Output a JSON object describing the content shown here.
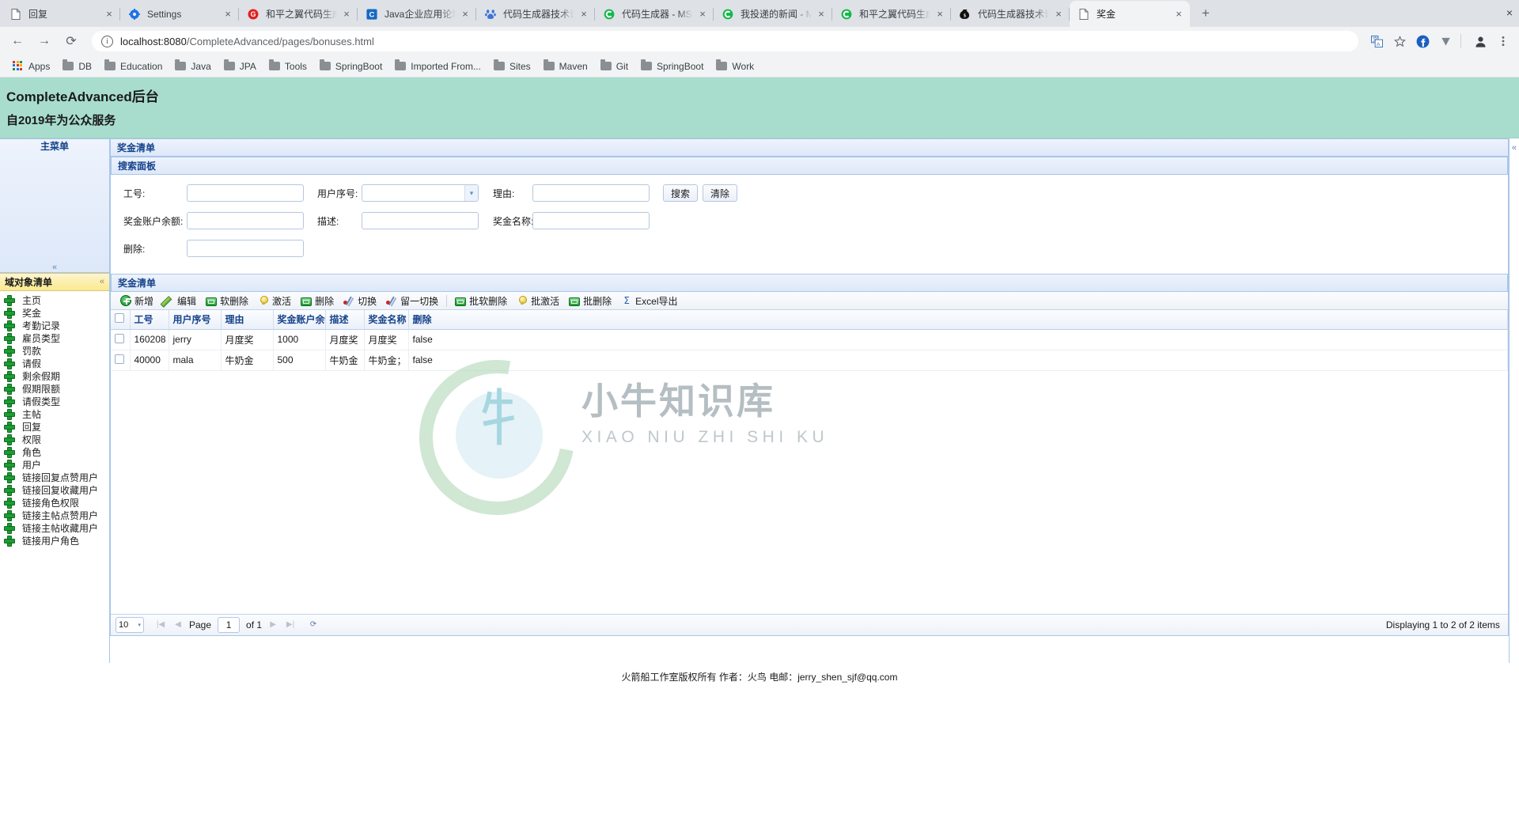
{
  "browser": {
    "tabs": [
      {
        "title": "回复",
        "favicon": "doc-icon",
        "active": false
      },
      {
        "title": "Settings",
        "favicon": "gear-icon",
        "active": false
      },
      {
        "title": "和平之翼代码生成",
        "favicon": "g-red-icon",
        "active": false
      },
      {
        "title": "Java企业应用论坛",
        "favicon": "c-blue-icon",
        "active": false
      },
      {
        "title": "代码生成器技术论",
        "favicon": "baidu-icon",
        "active": false
      },
      {
        "title": "代码生成器 - MSD",
        "favicon": "c-green-icon",
        "active": false
      },
      {
        "title": "我投递的新闻 - M",
        "favicon": "c-green-icon",
        "active": false
      },
      {
        "title": "和平之翼代码生成",
        "favicon": "c-green-icon",
        "active": false
      },
      {
        "title": "代码生成器技术论",
        "favicon": "moneybag-icon",
        "active": false
      },
      {
        "title": "奖金",
        "favicon": "doc-icon",
        "active": true
      }
    ],
    "tab_close_label": "×",
    "new_tab_label": "+",
    "window_close_label": "×",
    "nav": {
      "back": "←",
      "forward": "→",
      "reload": "⟳"
    },
    "omnibox": {
      "info_glyph": "i",
      "host": "localhost:8080",
      "path": "/CompleteAdvanced/pages/bonuses.html"
    },
    "toolbar_icons": [
      "translate-icon",
      "bookmark-star-icon",
      "extension-f-icon",
      "extension-v-icon",
      "profile-icon",
      "menu-kebab-icon"
    ],
    "bookmarks": [
      {
        "label": "Apps",
        "icon": "apps-grid-icon"
      },
      {
        "label": "DB",
        "icon": "folder-icon"
      },
      {
        "label": "Education",
        "icon": "folder-icon"
      },
      {
        "label": "Java",
        "icon": "folder-icon"
      },
      {
        "label": "JPA",
        "icon": "folder-icon"
      },
      {
        "label": "Tools",
        "icon": "folder-icon"
      },
      {
        "label": "SpringBoot",
        "icon": "folder-icon"
      },
      {
        "label": "Imported From...",
        "icon": "folder-icon"
      },
      {
        "label": "Sites",
        "icon": "folder-icon"
      },
      {
        "label": "Maven",
        "icon": "folder-icon"
      },
      {
        "label": "Git",
        "icon": "folder-icon"
      },
      {
        "label": "SpringBoot",
        "icon": "folder-icon"
      },
      {
        "label": "Work",
        "icon": "folder-icon"
      }
    ]
  },
  "app": {
    "title": "CompleteAdvanced后台",
    "subtitle": "自2019年为公众服务",
    "header_bg": "#a8ddcd"
  },
  "sidebar": {
    "main_menu_title": "主菜单",
    "main_menu_chevron": "«",
    "domain_title": "域对象清单",
    "domain_chevron": "«",
    "items": [
      {
        "label": "主页"
      },
      {
        "label": "奖金"
      },
      {
        "label": "考勤记录"
      },
      {
        "label": "雇员类型"
      },
      {
        "label": "罚款"
      },
      {
        "label": "请假"
      },
      {
        "label": "剩余假期"
      },
      {
        "label": "假期限额"
      },
      {
        "label": "请假类型"
      },
      {
        "label": "主帖"
      },
      {
        "label": "回复"
      },
      {
        "label": "权限"
      },
      {
        "label": "角色"
      },
      {
        "label": "用户"
      },
      {
        "label": "链接回复点赞用户"
      },
      {
        "label": "链接回复收藏用户"
      },
      {
        "label": "链接角色权限"
      },
      {
        "label": "链接主帖点赞用户"
      },
      {
        "label": "链接主帖收藏用户"
      },
      {
        "label": "链接用户角色"
      }
    ]
  },
  "main": {
    "region_title": "奖金清单",
    "right_collapse_chevron": "«",
    "search_panel": {
      "title": "搜索面板",
      "fields": [
        {
          "label": "工号:",
          "value": "",
          "type": "text"
        },
        {
          "label": "用户序号:",
          "value": "",
          "type": "combo"
        },
        {
          "label": "理由:",
          "value": "",
          "type": "text"
        },
        {
          "label": "奖金账户余额:",
          "value": "",
          "type": "text"
        },
        {
          "label": "描述:",
          "value": "",
          "type": "text"
        },
        {
          "label": "奖金名称:",
          "value": "",
          "type": "text"
        },
        {
          "label": "删除:",
          "value": "",
          "type": "text"
        }
      ],
      "search_button": "搜索",
      "clear_button": "清除"
    },
    "grid": {
      "title": "奖金清单",
      "toolbar": [
        {
          "label": "新增",
          "icon": "add-icon"
        },
        {
          "label": "编辑",
          "icon": "edit-pencil-icon"
        },
        {
          "label": "软删除",
          "icon": "soft-delete-icon"
        },
        {
          "label": "激活",
          "icon": "activate-bulb-icon"
        },
        {
          "label": "删除",
          "icon": "delete-icon"
        },
        {
          "label": "切换",
          "icon": "toggle-icon"
        },
        {
          "label": "留一切换",
          "icon": "toggle-one-icon"
        },
        {
          "label": "批软删除",
          "icon": "batch-soft-delete-icon"
        },
        {
          "label": "批激活",
          "icon": "batch-activate-icon"
        },
        {
          "label": "批删除",
          "icon": "batch-delete-icon"
        },
        {
          "label": "Excel导出",
          "icon": "excel-export-icon"
        }
      ],
      "columns": [
        "工号",
        "用户序号",
        "理由",
        "奖金账户余额",
        "描述",
        "奖金名称",
        "删除"
      ],
      "rows": [
        {
          "cells": [
            "160208",
            "jerry",
            "月度奖",
            "1000",
            "月度奖",
            "月度奖",
            "false"
          ]
        },
        {
          "cells": [
            "40000",
            "mala",
            "牛奶金",
            "500",
            "牛奶金",
            "牛奶金；",
            "false"
          ]
        }
      ],
      "footer": {
        "page_size": "10",
        "page_size_caret": "▾",
        "first_label": "|◀",
        "prev_label": "◀",
        "page_label": "Page",
        "page_value": "1",
        "of_label": "of 1",
        "next_label": "▶",
        "last_label": "▶|",
        "refresh_label": "⟳",
        "status": "Displaying 1 to 2 of 2 items"
      }
    }
  },
  "watermark": {
    "cn": "小牛知识库",
    "en": "XIAO NIU ZHI SHI KU",
    "mark": "牜"
  },
  "footer": {
    "text": "火箭船工作室版权所有 作者：火鸟 电邮：jerry_shen_sjf@qq.com"
  }
}
